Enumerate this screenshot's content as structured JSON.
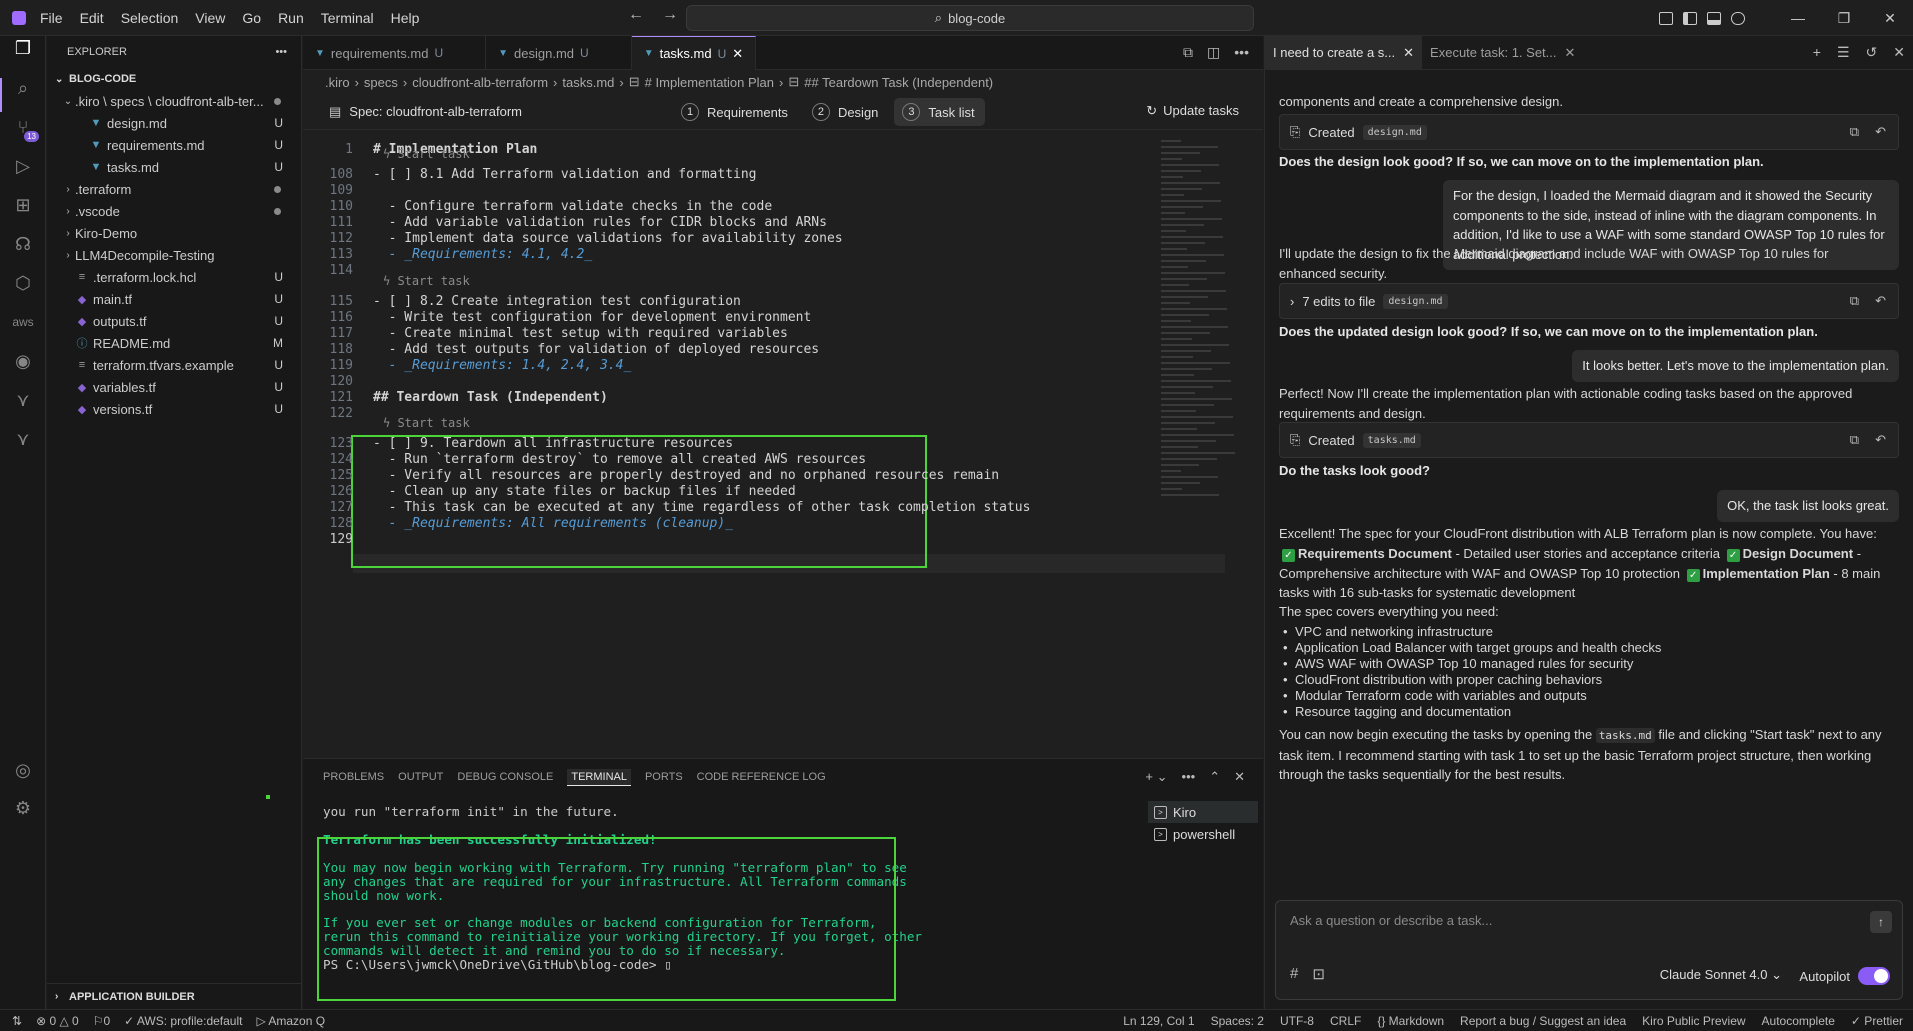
{
  "titlebar": {
    "menu": [
      "File",
      "Edit",
      "Selection",
      "View",
      "Go",
      "Run",
      "Terminal",
      "Help"
    ],
    "search_text": "blog-code"
  },
  "sidebar": {
    "title": "EXPLORER",
    "root": "BLOG-CODE",
    "items": [
      {
        "label": ".kiro \\ specs \\ cloudfront-alb-ter...",
        "status": "",
        "dot": true,
        "depth": 1,
        "chev": "⌄",
        "icon": ""
      },
      {
        "label": "design.md",
        "status": "U",
        "depth": 2,
        "icon": "md"
      },
      {
        "label": "requirements.md",
        "status": "U",
        "depth": 2,
        "icon": "md"
      },
      {
        "label": "tasks.md",
        "status": "U",
        "depth": 2,
        "icon": "md"
      },
      {
        "label": ".terraform",
        "status": "",
        "dot": true,
        "depth": 1,
        "chev": "›",
        "icon": ""
      },
      {
        "label": ".vscode",
        "status": "",
        "dot": true,
        "depth": 1,
        "chev": "›",
        "icon": ""
      },
      {
        "label": "Kiro-Demo",
        "status": "",
        "depth": 1,
        "chev": "›",
        "icon": ""
      },
      {
        "label": "LLM4Decompile-Testing",
        "status": "",
        "depth": 1,
        "chev": "›",
        "icon": ""
      },
      {
        "label": ".terraform.lock.hcl",
        "status": "U",
        "depth": 1,
        "icon": "lock"
      },
      {
        "label": "main.tf",
        "status": "U",
        "depth": 1,
        "icon": "tf"
      },
      {
        "label": "outputs.tf",
        "status": "U",
        "depth": 1,
        "icon": "tf"
      },
      {
        "label": "README.md",
        "status": "M",
        "depth": 1,
        "icon": "info"
      },
      {
        "label": "terraform.tfvars.example",
        "status": "U",
        "depth": 1,
        "icon": "lock"
      },
      {
        "label": "variables.tf",
        "status": "U",
        "depth": 1,
        "icon": "tf"
      },
      {
        "label": "versions.tf",
        "status": "U",
        "depth": 1,
        "icon": "tf"
      }
    ],
    "footer": "APPLICATION BUILDER"
  },
  "editor": {
    "tabs": [
      {
        "label": "requirements.md",
        "status": "U"
      },
      {
        "label": "design.md",
        "status": "U"
      },
      {
        "label": "tasks.md",
        "status": "U"
      }
    ],
    "breadcrumb": [
      ".kiro",
      "specs",
      "cloudfront-alb-terraform",
      "tasks.md",
      "# Implementation Plan",
      "## Teardown Task (Independent)"
    ],
    "spec_title": "Spec: cloudfront-alb-terraform",
    "steps": [
      {
        "n": "1",
        "label": "Requirements"
      },
      {
        "n": "2",
        "label": "Design"
      },
      {
        "n": "3",
        "label": "Task list"
      }
    ],
    "update_tasks": "Update tasks",
    "sticky": {
      "ln": "1",
      "text": "# Implementation Plan"
    },
    "codelens": "Start task",
    "lines": [
      {
        "ln": "108",
        "text": "- [ ] 8.1 Add Terraform validation and formatting"
      },
      {
        "ln": "109",
        "text": ""
      },
      {
        "ln": "110",
        "text": "  - Configure terraform validate checks in the code"
      },
      {
        "ln": "111",
        "text": "  - Add variable validation rules for CIDR blocks and ARNs"
      },
      {
        "ln": "112",
        "text": "  - Implement data source validations for availability zones"
      },
      {
        "ln": "113",
        "text": "  - _Requirements: 4.1, 4.2_"
      },
      {
        "ln": "114",
        "text": ""
      },
      {
        "ln": "115",
        "text": "- [ ] 8.2 Create integration test configuration"
      },
      {
        "ln": "116",
        "text": "  - Write test configuration for development environment"
      },
      {
        "ln": "117",
        "text": "  - Create minimal test setup with required variables"
      },
      {
        "ln": "118",
        "text": "  - Add test outputs for validation of deployed resources"
      },
      {
        "ln": "119",
        "text": "  - _Requirements: 1.4, 2.4, 3.4_"
      },
      {
        "ln": "120",
        "text": ""
      },
      {
        "ln": "121",
        "text": "## Teardown Task (Independent)"
      },
      {
        "ln": "122",
        "text": ""
      },
      {
        "ln": "123",
        "text": "- [ ] 9. Teardown all infrastructure resources"
      },
      {
        "ln": "124",
        "text": "  - Run `terraform destroy` to remove all created AWS resources"
      },
      {
        "ln": "125",
        "text": "  - Verify all resources are properly destroyed and no orphaned resources remain"
      },
      {
        "ln": "126",
        "text": "  - Clean up any state files or backup files if needed"
      },
      {
        "ln": "127",
        "text": "  - This task can be executed at any time regardless of other task completion status"
      },
      {
        "ln": "128",
        "text": "  - _Requirements: All requirements (cleanup)_"
      },
      {
        "ln": "129",
        "text": ""
      }
    ]
  },
  "panel": {
    "tabs": [
      "PROBLEMS",
      "OUTPUT",
      "DEBUG CONSOLE",
      "TERMINAL",
      "PORTS",
      "CODE REFERENCE LOG"
    ],
    "terminal_lines": [
      {
        "text": "you run \"terraform init\" in the future.",
        "style": "white"
      },
      {
        "text": "",
        "style": "white"
      },
      {
        "text": "Terraform has been successfully initialized!",
        "style": "bgreen"
      },
      {
        "text": "",
        "style": "white"
      },
      {
        "text": "You may now begin working with Terraform. Try running \"terraform plan\" to see",
        "style": "green"
      },
      {
        "text": "any changes that are required for your infrastructure. All Terraform commands",
        "style": "green"
      },
      {
        "text": "should now work.",
        "style": "green"
      },
      {
        "text": "",
        "style": "white"
      },
      {
        "text": "If you ever set or change modules or backend configuration for Terraform,",
        "style": "green"
      },
      {
        "text": "rerun this command to reinitialize your working directory. If you forget, other",
        "style": "green"
      },
      {
        "text": "commands will detect it and remind you to do so if necessary.",
        "style": "green"
      },
      {
        "text": "PS C:\\Users\\jwmck\\OneDrive\\GitHub\\blog-code> ",
        "style": "white"
      }
    ],
    "terminals": [
      "Kiro",
      "powershell"
    ]
  },
  "chat": {
    "tabs": [
      "I need to create a s...",
      "Execute task: 1. Set..."
    ],
    "input_placeholder": "Ask a question or describe a task...",
    "model": "Claude Sonnet 4.0",
    "autopilot_label": "Autopilot",
    "autopilot_on": true,
    "m0": "components and create a comprehensive design.",
    "created_label": "Created",
    "created_design_file": "design.md",
    "q_design": "Does the design look good? If so, we can move on to the implementation plan.",
    "user1": "For the design, I loaded the Mermaid diagram and it showed the Security components to the side, instead of inline with the diagram components. In addition, I'd like to use a WAF with some standard OWASP Top 10 rules for additional protection.",
    "reply1": "I'll update the design to fix the Mermaid diagram and include WAF with OWASP Top 10 rules for enhanced security.",
    "edits_label": "7 edits to file",
    "edits_file": "design.md",
    "q_updated": "Does the updated design look good? If so, we can move on to the implementation plan.",
    "user2": "It looks better. Let's move to the implementation plan.",
    "reply2": "Perfect! Now I'll create the implementation plan with actionable coding tasks based on the approved requirements and design.",
    "created_tasks_file": "tasks.md",
    "q_tasks": "Do the tasks look good?",
    "user3": "OK, the task list looks great.",
    "excellent": "Excellent! The spec for your CloudFront distribution with ALB Terraform plan is now complete. You have:",
    "have_items": [
      {
        "title": "Requirements Document",
        "desc": " - Detailed user stories and acceptance criteria "
      },
      {
        "title": "Design Document",
        "desc": " - Comprehensive architecture with WAF and OWASP Top 10 protection "
      },
      {
        "title": "Implementation Plan",
        "desc": " - 8 main tasks with 16 sub-tasks for systematic development"
      }
    ],
    "covers": "The spec covers everything you need:",
    "bullets": [
      "VPC and networking infrastructure",
      "Application Load Balancer with target groups and health checks",
      "AWS WAF with OWASP Top 10 managed rules for security",
      "CloudFront distribution with proper caching behaviors",
      "Modular Terraform code with variables and outputs",
      "Resource tagging and documentation"
    ],
    "final_pre": "You can now begin executing the tasks by opening the ",
    "final_code": "tasks.md",
    "final_post": " file and clicking \"Start task\" next to any task item. I recommend starting with task 1 to set up the basic Terraform project structure, then working through the tasks sequentially for the best results."
  },
  "statusbar": {
    "left": [
      "⊗ 0 △ 0",
      "⚐0",
      "✓ AWS: profile:default",
      "▷ Amazon Q"
    ],
    "right": [
      "Ln 129, Col 1",
      "Spaces: 2",
      "UTF-8",
      "CRLF",
      "{} Markdown",
      "Report a bug / Suggest an idea",
      "Kiro Public Preview",
      "Autocomplete",
      "✓ Prettier"
    ]
  },
  "colors": {
    "accent": "#8a5cf5",
    "highlight_box": "#4cd43b",
    "terminal_green": "#23d18b"
  }
}
